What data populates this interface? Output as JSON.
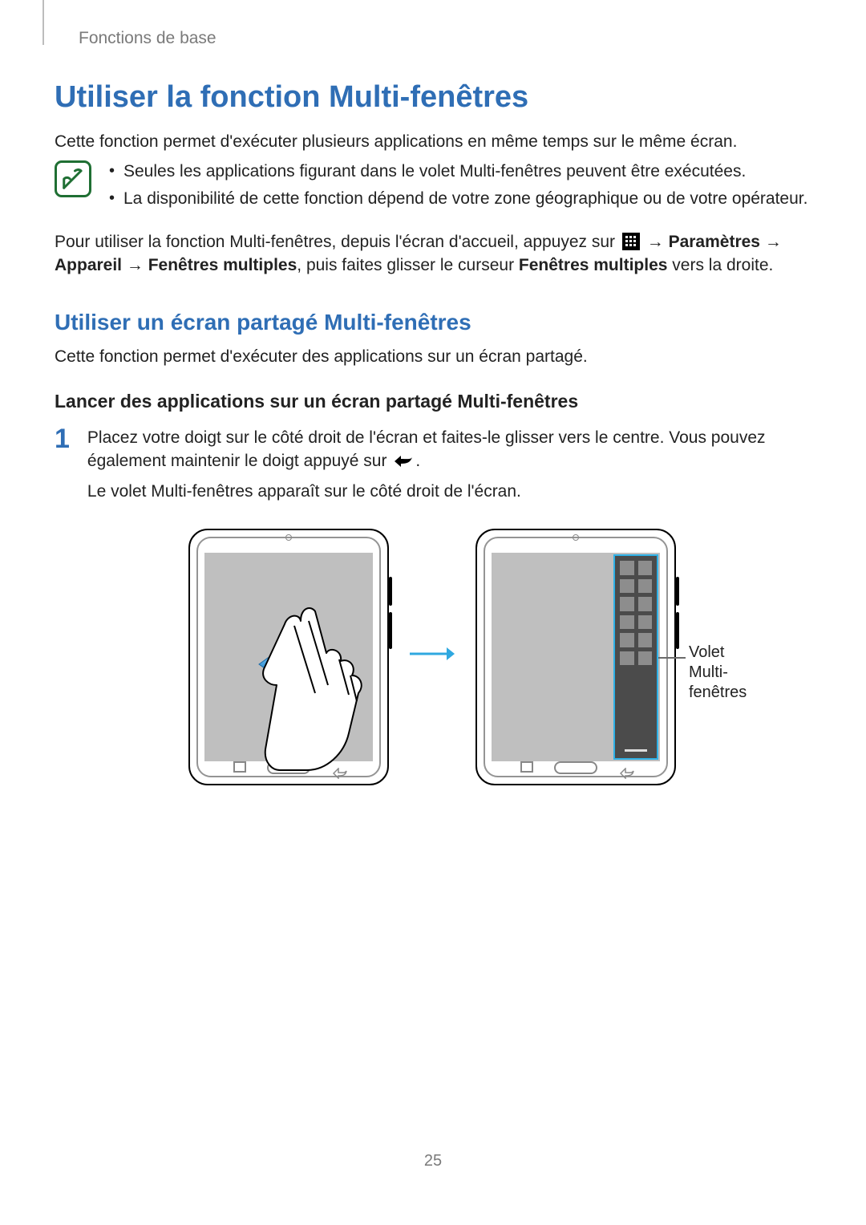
{
  "header": {
    "section": "Fonctions de base"
  },
  "title": "Utiliser la fonction Multi-fenêtres",
  "intro": "Cette fonction permet d'exécuter plusieurs applications en même temps sur le même écran.",
  "notes": [
    "Seules les applications figurant dans le volet Multi-fenêtres peuvent être exécutées.",
    "La disponibilité de cette fonction dépend de votre zone géographique ou de votre opérateur."
  ],
  "instruction2": {
    "pre": "Pour utiliser la fonction Multi-fenêtres, depuis l'écran d'accueil, appuyez sur ",
    "arrow1": " → ",
    "b1": "Paramètres",
    "arrow2": " → ",
    "b2": "Appareil",
    "arrow3": " → ",
    "b3": "Fenêtres multiples",
    "mid": ", puis faites glisser le curseur ",
    "b4": "Fenêtres multiples",
    "post": " vers la droite."
  },
  "h2": "Utiliser un écran partagé Multi-fenêtres",
  "h2_desc": "Cette fonction permet d'exécuter des applications sur un écran partagé.",
  "h3": "Lancer des applications sur un écran partagé Multi-fenêtres",
  "step1": {
    "num": "1",
    "line1a": "Placez votre doigt sur le côté droit de l'écran et faites-le glisser vers le centre. Vous pouvez également maintenir le doigt appuyé sur ",
    "line1b": ".",
    "line2": "Le volet Multi-fenêtres apparaît sur le côté droit de l'écran."
  },
  "callout": {
    "l1": "Volet",
    "l2": "Multi-fenêtres"
  },
  "pagenum": "25"
}
